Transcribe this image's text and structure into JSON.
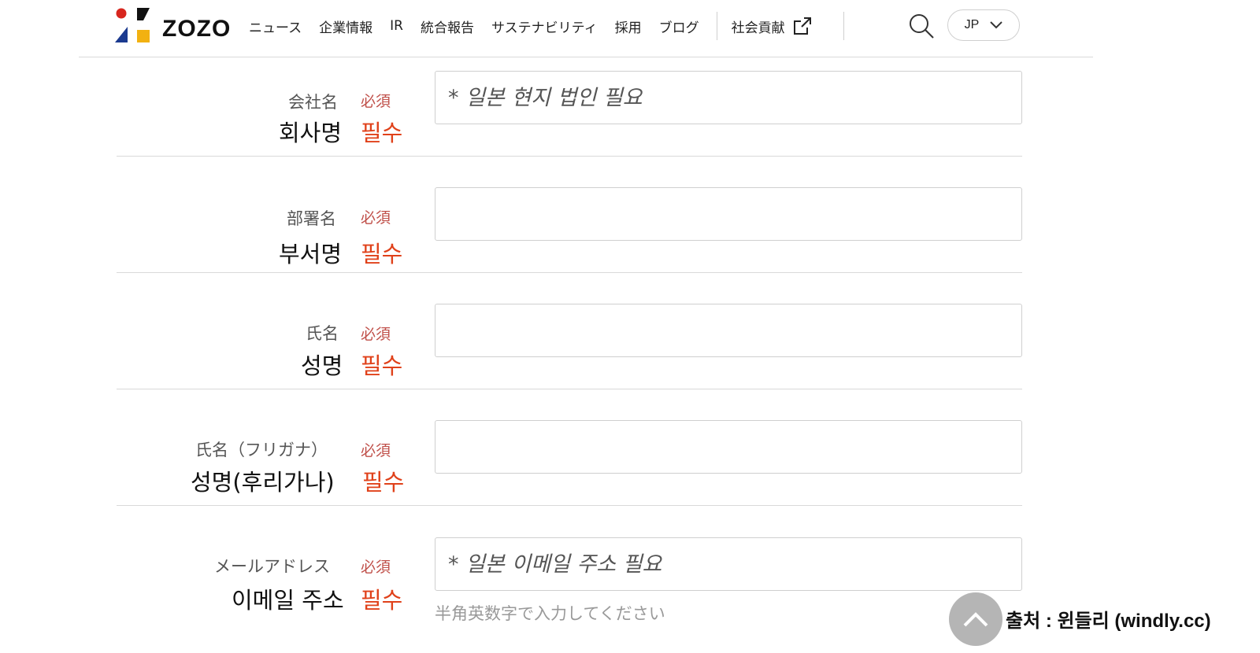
{
  "header": {
    "logo_text": "ZOZO",
    "nav": [
      "ニュース",
      "企業情報",
      "IR",
      "統合報告",
      "サステナビリティ",
      "採用",
      "ブログ"
    ],
    "external_link": "社会貢献",
    "language": "JP"
  },
  "form": {
    "rows": [
      {
        "label_ja": "会社名",
        "required_ja": "必須",
        "label_ko": "회사명",
        "required_ko": "필수",
        "placeholder": "* 일본 현지 법인 필요"
      },
      {
        "label_ja": "部署名",
        "required_ja": "必須",
        "label_ko": "부서명",
        "required_ko": "필수",
        "placeholder": ""
      },
      {
        "label_ja": "氏名",
        "required_ja": "必須",
        "label_ko": "성명",
        "required_ko": "필수",
        "placeholder": ""
      },
      {
        "label_ja": "氏名（フリガナ）",
        "required_ja": "必須",
        "label_ko": "성명(후리가나)",
        "required_ko": "필수",
        "placeholder": ""
      },
      {
        "label_ja": "メールアドレス",
        "required_ja": "必須",
        "label_ko": "이메일 주소",
        "required_ko": "필수",
        "placeholder": "* 일본 이메일 주소 필요"
      }
    ],
    "email_hint": "半角英数字で入力してください"
  },
  "credit": "출처 : 윈들리 (windly.cc)",
  "colors": {
    "required_ja": "#c0504a",
    "required_ko": "#e0411a",
    "divider": "#d9d9d9",
    "scroll_top_bg": "#b5b5b5"
  }
}
